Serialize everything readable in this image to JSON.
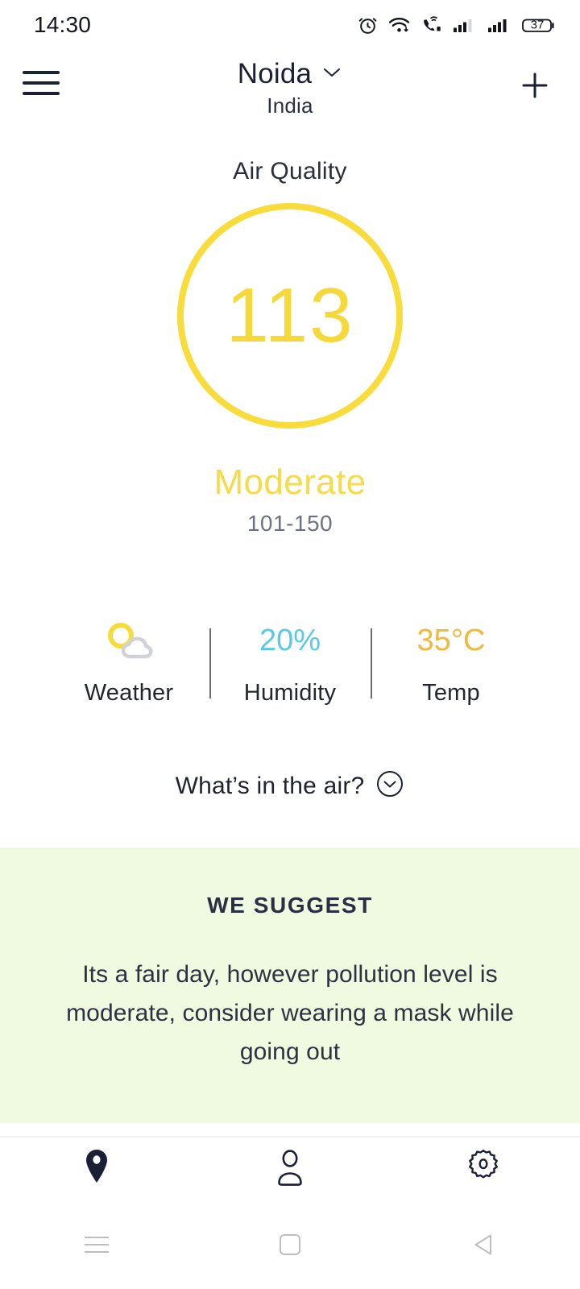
{
  "status_bar": {
    "time": "14:30",
    "battery_level": "37",
    "icons": [
      "alarm-icon",
      "wifi-icon",
      "vowifi-call-icon",
      "signal-one-icon",
      "signal-two-icon",
      "battery-icon"
    ]
  },
  "app_bar": {
    "menu_icon": "hamburger-menu-icon",
    "city": "Noida",
    "country": "India",
    "dropdown_icon": "chevron-down-icon",
    "add_icon": "plus-icon"
  },
  "air_quality": {
    "section_title": "Air Quality",
    "aqi_value": "113",
    "category": "Moderate",
    "range": "101-150",
    "ring_color": "#F7DC3C",
    "category_color": "#F5DB4A",
    "range_color": "#6e7280"
  },
  "stats": [
    {
      "icon": "partly-cloudy-icon",
      "value": "",
      "label": "Weather",
      "color": ""
    },
    {
      "icon": "",
      "value": "20%",
      "label": "Humidity",
      "color": "#5BC8E8"
    },
    {
      "icon": "",
      "value": "35°C",
      "label": "Temp",
      "color": "#F0B93B"
    }
  ],
  "whats_in_air": {
    "label": "What’s in the air?",
    "icon": "chevron-down-circle-icon"
  },
  "suggestion": {
    "title": "WE SUGGEST",
    "body": "Its a fair day, however pollution level is moderate, consider wearing a mask while going out",
    "background": "#EFFAE0"
  },
  "bottom_nav": [
    {
      "name": "location-pin-icon",
      "label": "Location",
      "active": true
    },
    {
      "name": "user-profile-icon",
      "label": "Profile",
      "active": false
    },
    {
      "name": "settings-gear-icon",
      "label": "Settings",
      "active": false
    }
  ],
  "system_nav": [
    {
      "name": "recents-icon",
      "label": "Recents"
    },
    {
      "name": "home-icon",
      "label": "Home"
    },
    {
      "name": "back-icon",
      "label": "Back"
    }
  ]
}
